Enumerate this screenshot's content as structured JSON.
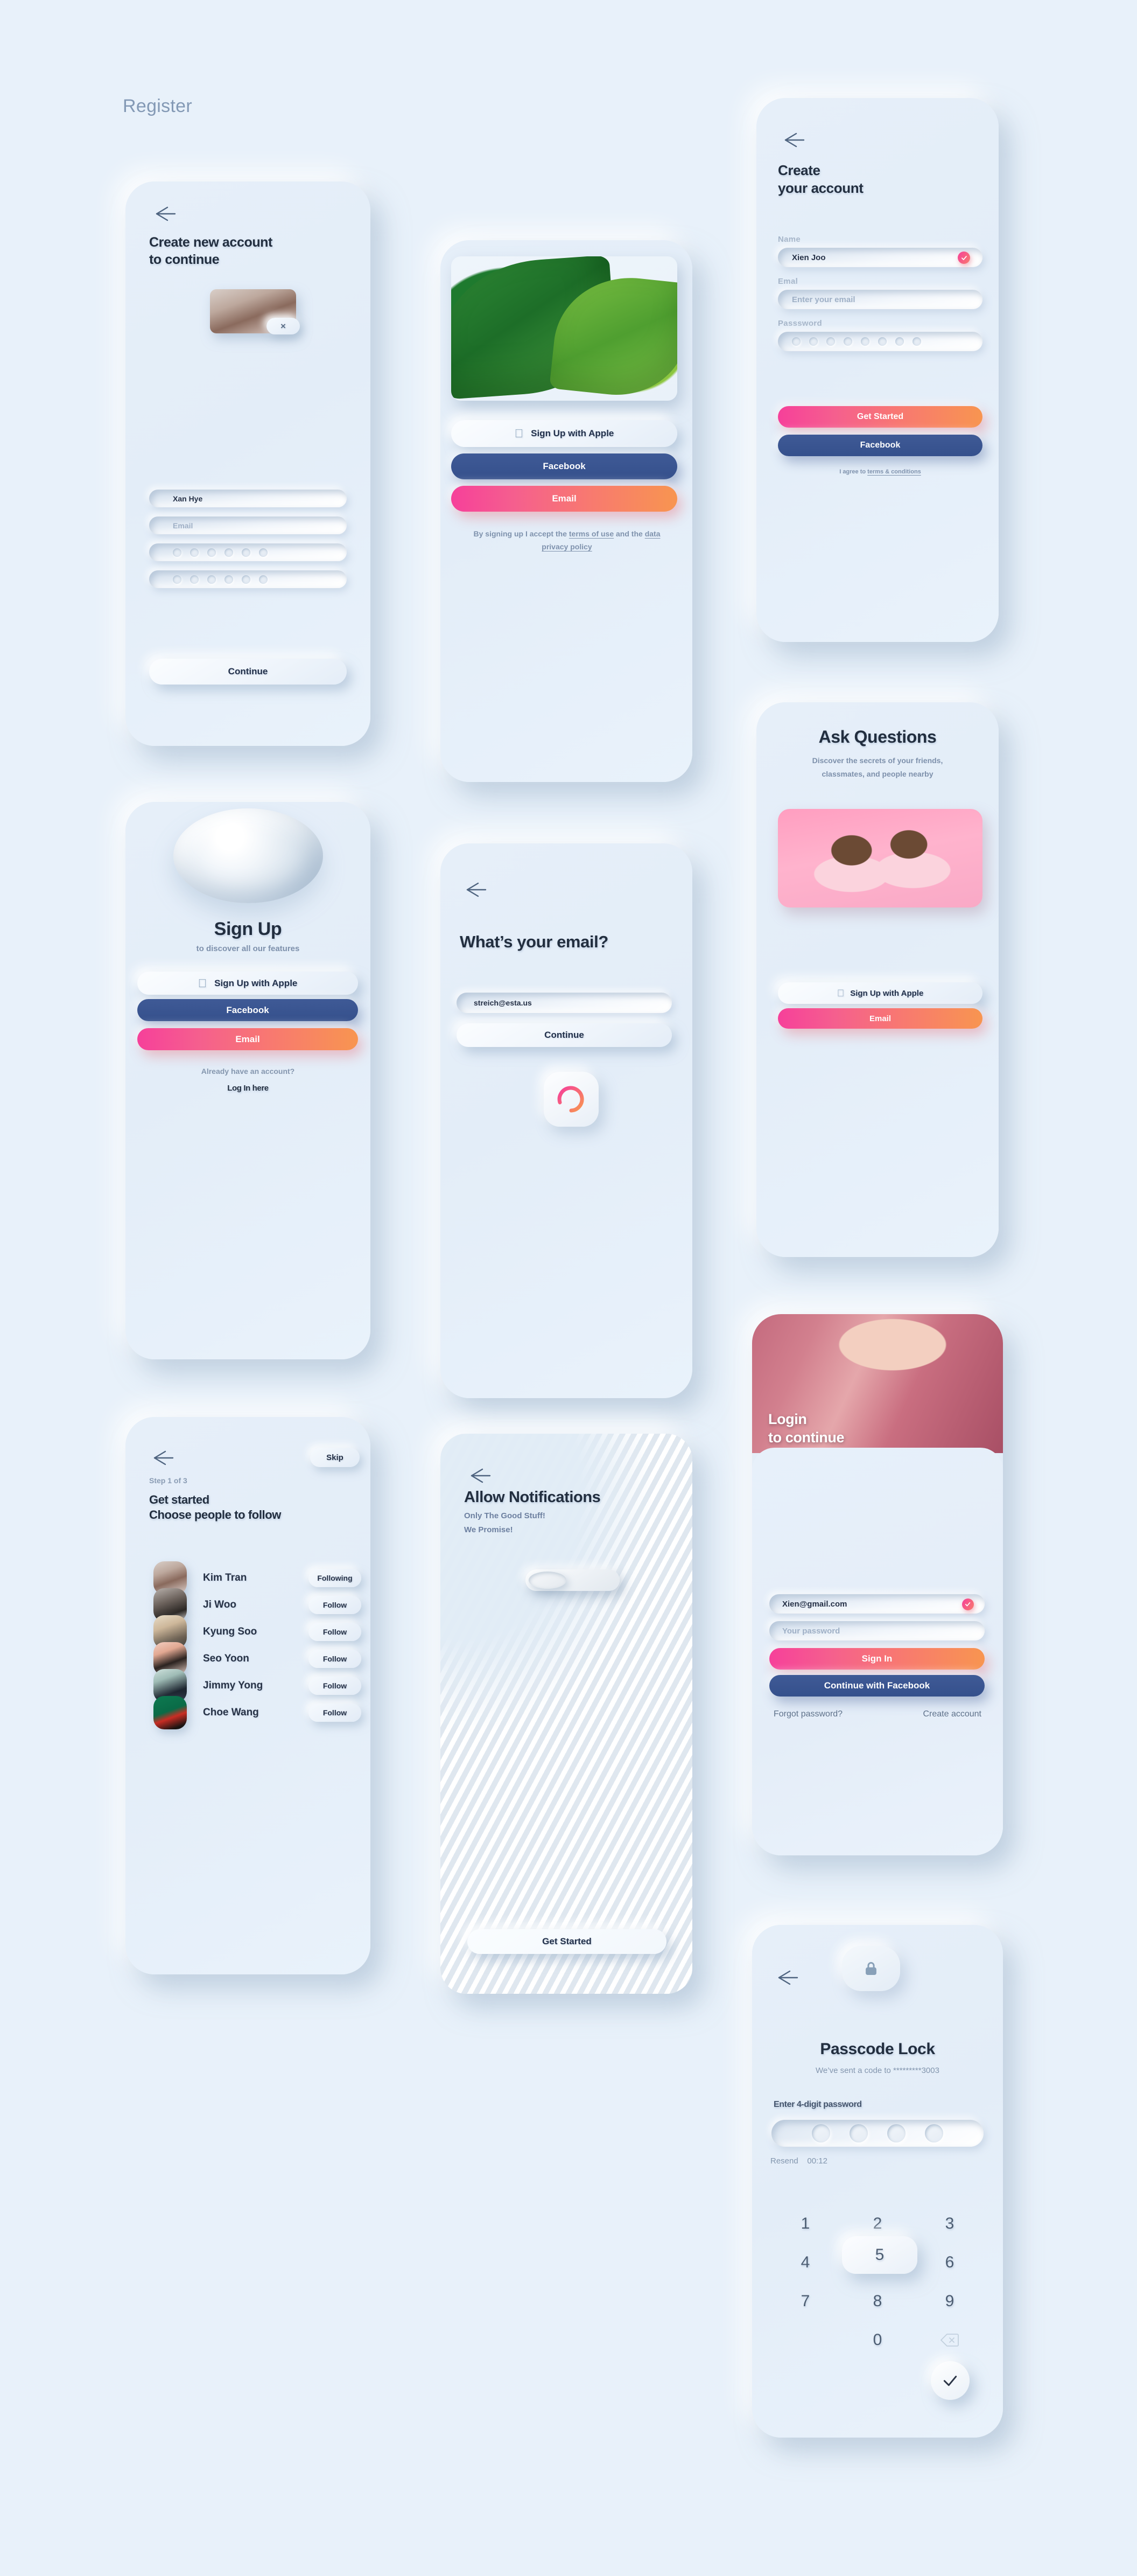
{
  "page": {
    "title": "Register"
  },
  "icons": {
    "apple": "",
    "back_arrow": "back-arrow-icon",
    "lock": "lock-icon",
    "check": "check-icon",
    "backspace": "backspace-icon"
  },
  "card_create_new_account": {
    "title_line1": "Create new account",
    "title_line2": "to continue",
    "avatar_remove_label": "×",
    "name_value": "Xan Hye",
    "email_placeholder": "Email",
    "password_masked": "••••••",
    "confirm_masked": "••••••",
    "continue_label": "Continue"
  },
  "card_signup_social": {
    "apple_label": "Sign Up with Apple",
    "facebook_label": "Facebook",
    "email_label": "Email",
    "legal_prefix": "By signing up I accept the ",
    "legal_link1": "terms of use",
    "legal_mid": " and the ",
    "legal_link2": "data privacy policy"
  },
  "card_create_your_account": {
    "title_line1": "Create",
    "title_line2": "your account",
    "name_label": "Name",
    "name_value": "Xien Joo",
    "email_label": "Emal",
    "email_placeholder": "Enter your email",
    "password_label": "Passsword",
    "password_masked": "••••••••",
    "get_started_label": "Get Started",
    "facebook_label": "Facebook",
    "terms_prefix": "I agree to ",
    "terms_link": "terms & conditions"
  },
  "card_signup_hero": {
    "title": "Sign Up",
    "subtitle": "to discover all our features",
    "apple_label": "Sign Up with Apple",
    "facebook_label": "Facebook",
    "email_label": "Email",
    "already_label": "Already have an account?",
    "login_label": "Log In here"
  },
  "card_whats_your_email": {
    "title": "What’s your email?",
    "email_value": "streich@esta.us",
    "continue_label": "Continue"
  },
  "card_ask_questions": {
    "title": "Ask Questions",
    "subtitle_line1": "Discover the secrets of your friends,",
    "subtitle_line2": "classmates, and people nearby",
    "apple_label": "Sign Up with Apple",
    "email_label": "Email"
  },
  "card_get_started_follow": {
    "skip_label": "Skip",
    "step_label": "Step 1 of 3",
    "title_line1": "Get started",
    "title_line2": "Choose people to follow",
    "people": [
      {
        "name": "Kim Tran",
        "action": "Following"
      },
      {
        "name": "Ji Woo",
        "action": "Follow"
      },
      {
        "name": "Kyung Soo",
        "action": "Follow"
      },
      {
        "name": "Seo Yoon",
        "action": "Follow"
      },
      {
        "name": "Jimmy Yong",
        "action": "Follow"
      },
      {
        "name": "Choe Wang",
        "action": "Follow"
      }
    ]
  },
  "card_allow_notifications": {
    "title": "Allow Notifications",
    "subtitle_line1": "Only The Good Stuff!",
    "subtitle_line2": "We Promise!",
    "get_started_label": "Get Started"
  },
  "card_login": {
    "title_line1": "Login",
    "title_line2": "to continue",
    "email_value": "Xien@gmail.com",
    "password_placeholder": "Your password",
    "sign_in_label": "Sign In",
    "facebook_label": "Continue with Facebook",
    "forgot_label": "Forgot password?",
    "create_label": "Create account"
  },
  "card_passcode": {
    "title": "Passcode Lock",
    "sent_prefix": "We’ve sent a code to",
    "masked_number": "*********3003",
    "field_label": "Enter 4-digit password",
    "resend_label": "Resend",
    "resend_timer": "00:12",
    "keys": [
      "1",
      "2",
      "3",
      "4",
      "5",
      "6",
      "7",
      "8",
      "9",
      "0"
    ],
    "active_key": "5"
  },
  "colors": {
    "background": "#e8f1fa",
    "facebook": "#3b5998",
    "gradient_start": "#f6409a",
    "gradient_end": "#f89550",
    "title_text": "#222e3f",
    "muted_text": "#7d90ab"
  }
}
